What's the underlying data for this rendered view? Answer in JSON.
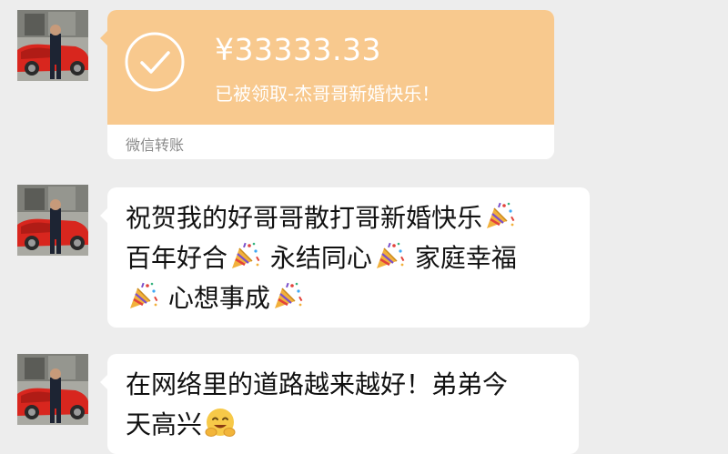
{
  "transfer": {
    "amount": "¥33333.33",
    "status_text": "已被领取-杰哥哥新婚快乐！",
    "footer_label": "微信转账",
    "card_color": "#f8c98e"
  },
  "messages": [
    {
      "lines": [
        "祝贺我的好哥哥散打哥新婚快乐",
        "百年好合",
        "永结同心",
        "家庭幸福",
        "心想事成"
      ]
    },
    {
      "lines": [
        "在网络里的道路越来越好！弟弟今",
        "天高兴"
      ]
    }
  ],
  "icons": {
    "transfer_check": "check-circle-icon",
    "party": "party-popper-emoji",
    "smile": "smiling-face-emoji"
  },
  "colors": {
    "background": "#ededed",
    "bubble": "#ffffff",
    "text": "#111111"
  }
}
